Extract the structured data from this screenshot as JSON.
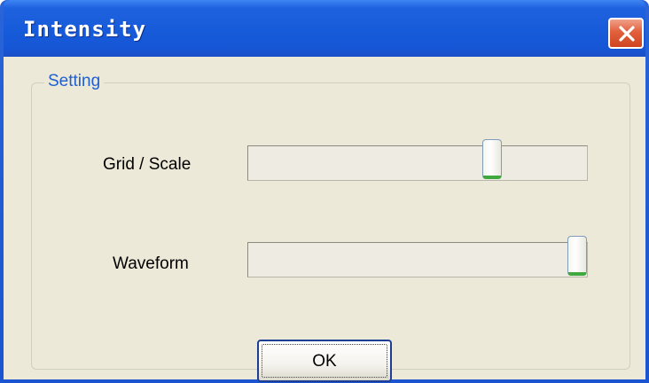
{
  "window": {
    "title": "Intensity",
    "close_icon": "close-icon"
  },
  "group": {
    "label": "Setting"
  },
  "sliders": [
    {
      "label": "Grid / Scale",
      "level_percent": 72
    },
    {
      "label": "Waveform",
      "level_percent": 97
    }
  ],
  "buttons": {
    "ok_label": "OK"
  },
  "colors": {
    "titlebar": "#1656d6",
    "close_button": "#e2603c",
    "dialog_background": "#ece9d8",
    "group_label": "#1f5fd0",
    "slider_thumb_accent": "#3fa83f"
  }
}
